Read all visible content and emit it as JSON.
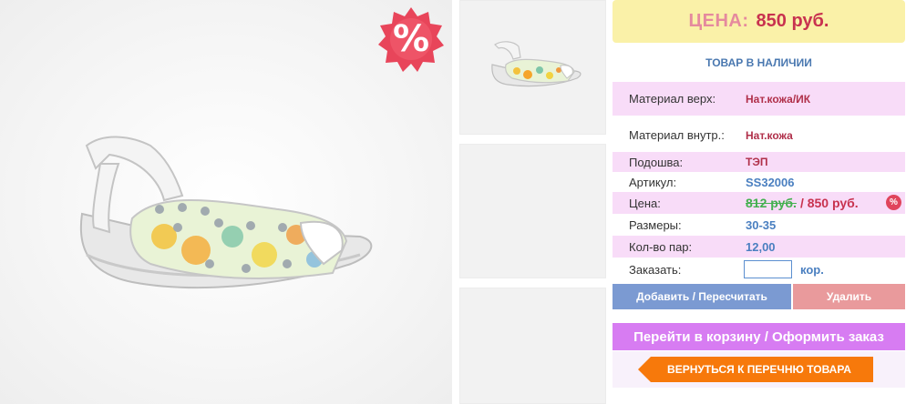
{
  "main_photo": {
    "sale_badge": "%"
  },
  "thumbnails": [
    {
      "name": "thumb-side-view"
    },
    {
      "name": "thumb-empty"
    },
    {
      "name": "thumb-empty"
    }
  ],
  "product": {
    "price_label": "ЦЕНА:",
    "price_value": "850 руб.",
    "stock_status": "ТОВАР В НАЛИЧИИ",
    "details": [
      {
        "label": "Материал верх:",
        "value": "Нат.кожа/ИК"
      },
      {
        "label": "Материал внутр.:",
        "value": "Нат.кожа"
      },
      {
        "label": "Подошва:",
        "value": "ТЭП"
      },
      {
        "label": "Артикул:",
        "value": "SS32006"
      },
      {
        "label": "Цена:",
        "old_price": "812 руб.",
        "new_price": "/ 850 руб.",
        "badge": "%"
      },
      {
        "label": "Размеры:",
        "value": "30-35"
      },
      {
        "label": "Кол-во пар:",
        "value": "12,00"
      }
    ],
    "order": {
      "label": "Заказать:",
      "input_value": "",
      "unit": "кор."
    }
  },
  "actions": {
    "add_label": "Добавить / Пересчитать",
    "delete_label": "Удалить",
    "cart_label": "Перейти в корзину / Оформить заказ",
    "back_label": "ВЕРНУТЬСЯ К ПЕРЕЧНЮ ТОВАРА"
  },
  "colors": {
    "price_box_bg": "#faf1a8",
    "accent_pink": "#f8dcf8",
    "price_red": "#c8324f",
    "link_blue": "#4a7fc0",
    "btn_add": "#7b9ad2",
    "btn_delete": "#e99a9c",
    "btn_cart": "#d77cf2",
    "btn_back": "#f7790b"
  }
}
